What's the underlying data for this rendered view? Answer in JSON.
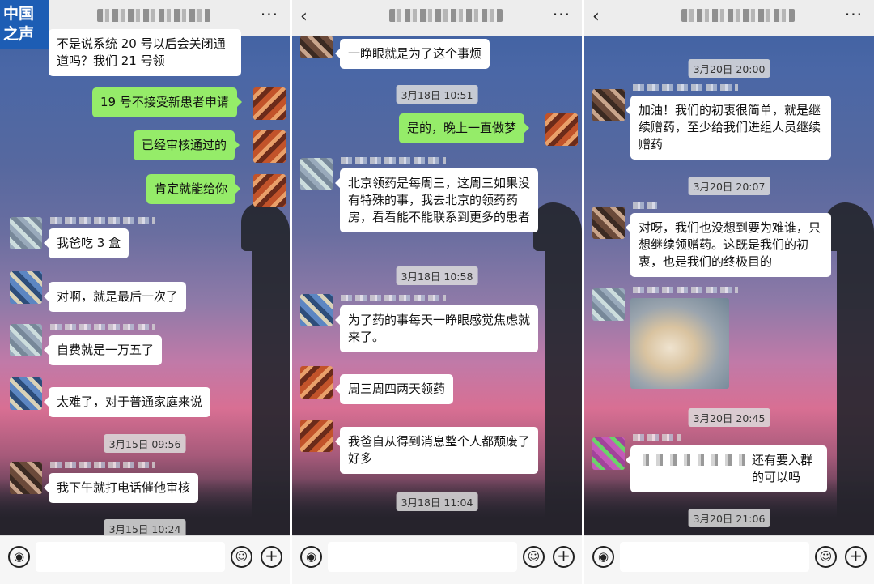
{
  "logo": {
    "line1": "中国",
    "line2": "之声"
  },
  "header": {
    "more": "···",
    "back": "‹"
  },
  "panel1": {
    "messages": [
      {
        "text": "不是说系统 20 号以后会关闭通道吗？我们 21 号领"
      },
      {
        "text": "19 号不接受新患者申请"
      },
      {
        "text": "已经审核通过的"
      },
      {
        "text": "肯定就能给你"
      },
      {
        "text": "我爸吃 3 盒"
      },
      {
        "text": "对啊，就是最后一次了"
      },
      {
        "text": "自费就是一万五了"
      },
      {
        "text": "太难了，对于普通家庭来说"
      },
      {
        "text": "我下午就打电话催他审核"
      }
    ],
    "ts1": "3月15日 09:56",
    "ts2": "3月15日 10:24"
  },
  "panel2": {
    "messages": [
      {
        "text": "一睁眼就是为了这个事烦"
      },
      {
        "text": "是的，晚上一直做梦"
      },
      {
        "text": "北京领药是每周三，这周三如果没有特殊的事，我去北京的领药药房，看看能不能联系到更多的患者"
      },
      {
        "text": "为了药的事每天一睁眼感觉焦虑就来了。"
      },
      {
        "text": "周三周四两天领药"
      },
      {
        "text": "我爸自从得到消息整个人都颓废了好多"
      }
    ],
    "ts1": "3月18日 10:51",
    "ts2": "3月18日 10:58",
    "ts3": "3月18日 11:04"
  },
  "panel3": {
    "messages": [
      {
        "text": "加油！我们的初衷很简单，就是继续赠药，至少给我们进组人员继续赠药"
      },
      {
        "text": "对呀，我们也没想到要为难谁，只想继续领赠药。这既是我们的初衷，也是我们的终极目的"
      },
      {
        "text": "还有要入群的可以吗"
      }
    ],
    "ts1": "3月20日 20:00",
    "ts2": "3月20日 20:07",
    "ts3": "3月20日 20:45",
    "ts4": "3月20日 21:06"
  },
  "input_bar": {
    "voice_icon": "voice-icon",
    "emoji_icon": "emoji-icon",
    "plus_icon": "plus-icon"
  },
  "colors": {
    "sent_bubble": "#95ec69",
    "received_bubble": "#ffffff",
    "header_bg": "#ededed"
  }
}
